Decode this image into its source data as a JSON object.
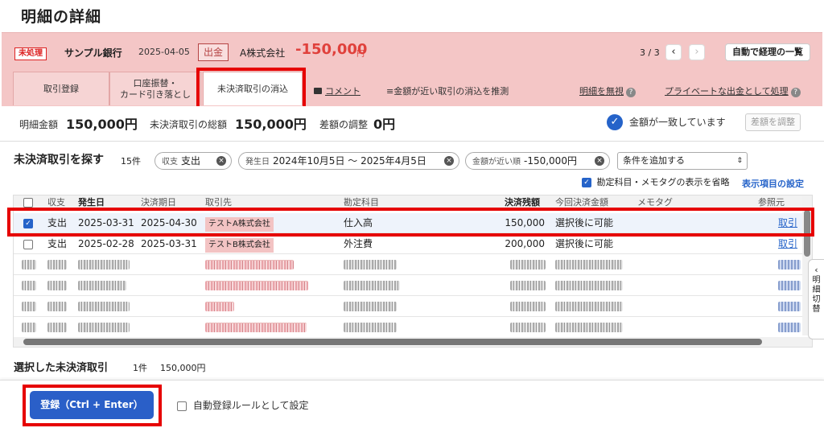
{
  "page_title": "明細の詳細",
  "transaction": {
    "status": "未処理",
    "bank": "サンプル銀行",
    "date": "2025-04-05",
    "type": "出金",
    "partner": "A株式会社",
    "amount": "-150,000",
    "amount_unit": "円"
  },
  "pager": {
    "position": "3 / 3",
    "prev": "‹",
    "next": "›"
  },
  "auto_button": "自動で経理の一覧",
  "tabs": [
    {
      "label": "取引登録"
    },
    {
      "label_line1": "口座振替・",
      "label_line2": "カード引き落とし"
    },
    {
      "label": "未決済取引の消込"
    }
  ],
  "tab_links": {
    "comment": "コメント",
    "suggest": "金額が近い取引の消込を推測",
    "ignore": "明細を無視",
    "private": "プライベートな出金として処理"
  },
  "summary": {
    "detail_label": "明細金額",
    "detail_value": "150,000円",
    "unsettled_label": "未決済取引の総額",
    "unsettled_value": "150,000円",
    "diff_label": "差額の調整",
    "diff_value": "0円",
    "match_text": "金額が一致しています",
    "adjust_button": "差額を調整"
  },
  "search": {
    "title": "未決済取引を探す",
    "count": "15件",
    "chips": [
      {
        "key": "収支",
        "value": "支出"
      },
      {
        "key": "発生日",
        "value": "2024年10月5日 ～ 2025年4月5日"
      },
      {
        "key": "金額が近い順",
        "value": "-150,000円"
      }
    ],
    "add_condition": "条件を追加する",
    "omit_option": "勘定科目・メモタグの表示を省略",
    "display_settings": "表示項目の設定"
  },
  "table": {
    "headers": [
      "収支",
      "発生日",
      "決済期日",
      "取引先",
      "勘定科目",
      "決済残額",
      "今回決済金額",
      "メモタグ",
      "参照元"
    ],
    "rows": [
      {
        "type": "支出",
        "date": "2025-03-31",
        "due": "2025-04-30",
        "partner": "テストA株式会社",
        "account": "仕入高",
        "remaining": "150,000",
        "this_time": "選択後に可能",
        "ref": "取引"
      },
      {
        "type": "支出",
        "date": "2025-02-28",
        "due": "2025-03-31",
        "partner": "テストB株式会社",
        "account": "外注費",
        "remaining": "200,000",
        "this_time": "選択後に可能",
        "ref": "取引"
      }
    ]
  },
  "side_tab": "明細切替",
  "selected": {
    "title": "選択した未決済取引",
    "count": "1件",
    "amount": "150,000円"
  },
  "footer": {
    "register": "登録（Ctrl + Enter）",
    "auto_rule": "自動登録ルールとして設定"
  },
  "colors": {
    "accent_red": "#e0413c",
    "brand_blue": "#2563c9",
    "pink_bg": "#f4c6c6"
  }
}
